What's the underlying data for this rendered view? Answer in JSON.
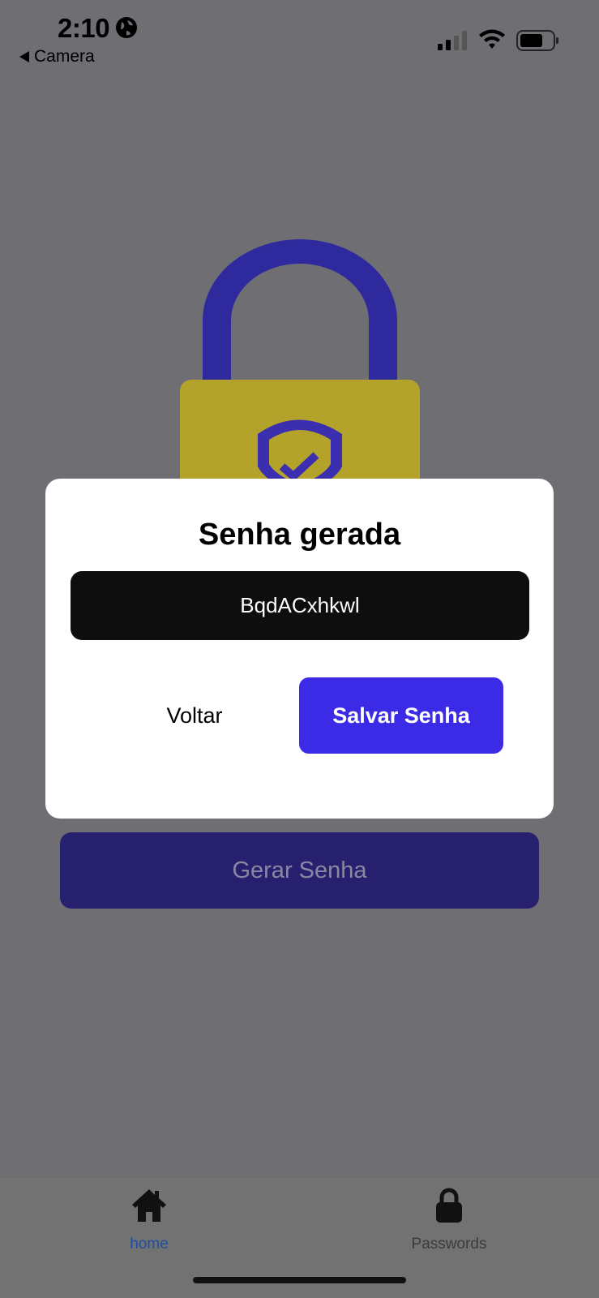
{
  "status_bar": {
    "time": "2:10",
    "back_app": "Camera",
    "icons": [
      "globe-icon",
      "signal-icon",
      "wifi-icon",
      "battery-icon"
    ]
  },
  "illustration": {
    "name": "padlock-with-shield-icon",
    "colors": {
      "shackle": "#2e2a9e",
      "body": "#b8a72a",
      "shield": "#3b2fb0"
    }
  },
  "main": {
    "generate_button_label": "Gerar Senha"
  },
  "modal": {
    "title": "Senha gerada",
    "generated_password": "BqdACxhkwl",
    "back_label": "Voltar",
    "save_label": "Salvar Senha"
  },
  "tab_bar": {
    "items": [
      {
        "label": "home",
        "icon": "home-icon",
        "active": true
      },
      {
        "label": "Passwords",
        "icon": "lock-icon",
        "active": false
      }
    ]
  },
  "colors": {
    "accent": "#3b2be6",
    "overlay": "#6f6f73",
    "active_tab": "#1f4fa3"
  }
}
